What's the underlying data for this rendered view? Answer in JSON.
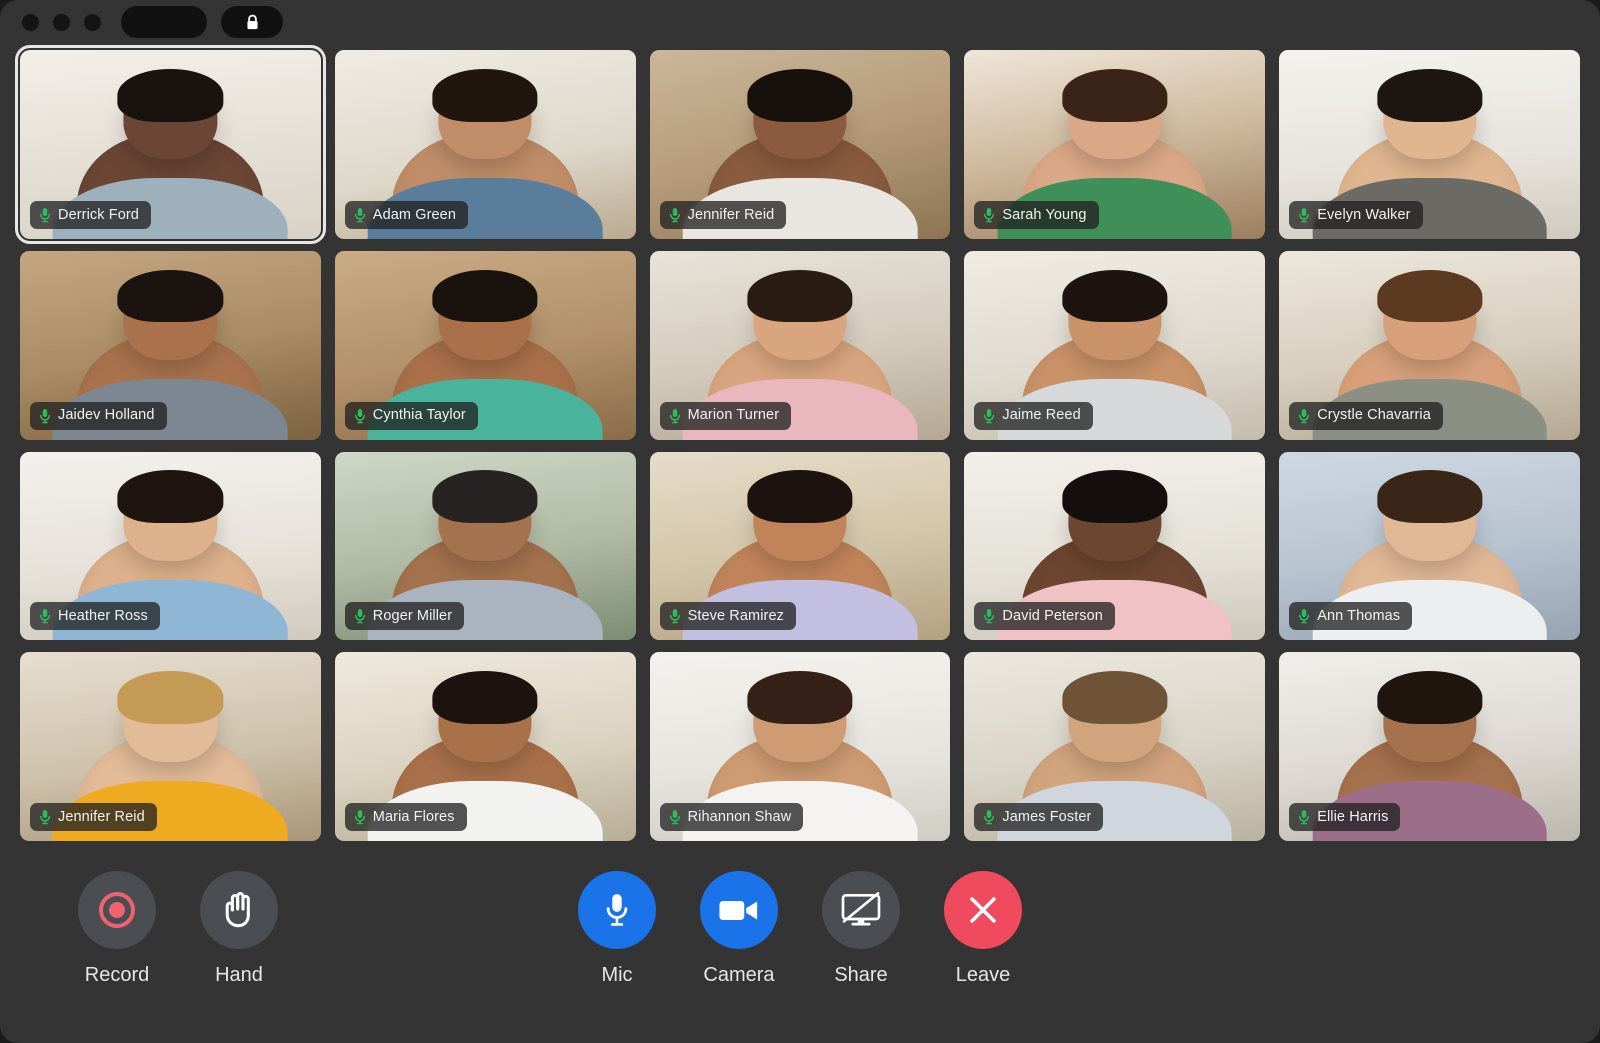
{
  "window": {
    "titlebar": {
      "traffic_lights": [
        "close",
        "minimize",
        "maximize"
      ],
      "pill_wide_label": "",
      "pill_lock_icon": "lock-icon"
    },
    "background_color": "#343434"
  },
  "meeting": {
    "grid": {
      "columns": 5,
      "rows": 4,
      "participant_count": 20
    },
    "active_speaker": "Derrick Ford",
    "participants": [
      {
        "name": "Derrick Ford",
        "mic_icon": "mic-on-icon",
        "mic_status": "on",
        "active": true,
        "skin": "#6b4634",
        "hair": "#191310",
        "shirt": "#9fb0bd",
        "bg": "linear-gradient(175deg,#f2efe9 0%,#e7e2d9 46%,#d8d2c6 100%)"
      },
      {
        "name": "Adam Green",
        "mic_icon": "mic-on-icon",
        "mic_status": "on",
        "active": false,
        "skin": "#c08d68",
        "hair": "#20160f",
        "shirt": "#5b7d9c",
        "bg": "linear-gradient(170deg,#efece4 0%,#ded8ca 58%,#b9a98f 100%)"
      },
      {
        "name": "Jennifer Reid",
        "mic_icon": "mic-on-icon",
        "mic_status": "on",
        "active": false,
        "skin": "#8a5b3e",
        "hair": "#17100c",
        "shirt": "#e9e6e1",
        "bg": "linear-gradient(165deg,#cbb79a 0%,#b59b79 50%,#8d7554 100%)"
      },
      {
        "name": "Sarah Young",
        "mic_icon": "mic-on-icon",
        "mic_status": "on",
        "active": false,
        "skin": "#dba887",
        "hair": "#3a2418",
        "shirt": "#3f8f58",
        "bg": "linear-gradient(170deg,#efe6d8 0%,#cdb79b 52%,#9b7e5e 100%)"
      },
      {
        "name": "Evelyn Walker",
        "mic_icon": "mic-on-icon",
        "mic_status": "on",
        "active": false,
        "skin": "#e0b690",
        "hair": "#1d1512",
        "shirt": "#6c6a64",
        "bg": "linear-gradient(175deg,#f4f2ee 0%,#e6e3dc 60%,#cfcac0 100%)"
      },
      {
        "name": "Jaidev Holland",
        "mic_icon": "mic-on-icon",
        "mic_status": "on",
        "active": false,
        "skin": "#a9724d",
        "hair": "#1b1310",
        "shirt": "#7d8792",
        "bg": "linear-gradient(170deg,#c4a782 0%,#a98b64 52%,#7d6340 100%)"
      },
      {
        "name": "Cynthia Taylor",
        "mic_icon": "mic-on-icon",
        "mic_status": "on",
        "active": false,
        "skin": "#a9704a",
        "hair": "#1a120d",
        "shirt": "#49b39c",
        "bg": "linear-gradient(170deg,#c9ab86 0%,#b1906a 55%,#8a6c49 100%)"
      },
      {
        "name": "Marion Turner",
        "mic_icon": "mic-on-icon",
        "mic_status": "on",
        "active": false,
        "skin": "#d9a57f",
        "hair": "#2b1c13",
        "shirt": "#e9b7bd",
        "bg": "linear-gradient(172deg,#e8e3d9 0%,#d3cabb 55%,#b3a794 100%)"
      },
      {
        "name": "Jaime Reed",
        "mic_icon": "mic-on-icon",
        "mic_status": "on",
        "active": false,
        "skin": "#c99268",
        "hair": "#1d1410",
        "shirt": "#d6d8da",
        "bg": "linear-gradient(172deg,#f0ece4 0%,#dfd9ce 58%,#c4bcac 100%)"
      },
      {
        "name": "Crystle Chavarria",
        "mic_icon": "mic-on-icon",
        "mic_status": "on",
        "active": false,
        "skin": "#d7a07a",
        "hair": "#5c3a22",
        "shirt": "#8b8f84",
        "bg": "linear-gradient(172deg,#ede7dc 0%,#d6cdbd 56%,#b4a892 100%)"
      },
      {
        "name": "Heather Ross",
        "mic_icon": "mic-on-icon",
        "mic_status": "on",
        "active": false,
        "skin": "#dcb18c",
        "hair": "#1e1410",
        "shirt": "#8fb6d4",
        "bg": "linear-gradient(175deg,#f3f1ec 0%,#e6e2da 58%,#d0cabe 100%)"
      },
      {
        "name": "Roger Miller",
        "mic_icon": "mic-on-icon",
        "mic_status": "on",
        "active": false,
        "skin": "#a4724e",
        "hair": "#262322",
        "shirt": "#aab4c0",
        "bg": "linear-gradient(172deg,#cfd6c6 0%,#b0bba4 52%,#7e8c74 100%)"
      },
      {
        "name": "Steve Ramirez",
        "mic_icon": "mic-on-icon",
        "mic_status": "on",
        "active": false,
        "skin": "#c1845a",
        "hair": "#1c130e",
        "shirt": "#c3bfe0",
        "bg": "linear-gradient(172deg,#e6dcc8 0%,#d2c4a8 55%,#b3a181 100%)"
      },
      {
        "name": "David Peterson",
        "mic_icon": "mic-on-icon",
        "mic_status": "on",
        "active": false,
        "skin": "#6d4631",
        "hair": "#140f0c",
        "shirt": "#f0c2c6",
        "bg": "linear-gradient(175deg,#f2f0ea 0%,#e4e1d8 58%,#ccc8bb 100%)"
      },
      {
        "name": "Ann Thomas",
        "mic_icon": "mic-on-icon",
        "mic_status": "on",
        "active": false,
        "skin": "#e1b896",
        "hair": "#3a2519",
        "shirt": "#eceef0",
        "bg": "linear-gradient(172deg,#cfd8e2 0%,#b9c4d1 52%,#97a3b2 100%)"
      },
      {
        "name": "Jennifer Reid",
        "mic_icon": "mic-on-icon",
        "mic_status": "on",
        "active": false,
        "skin": "#e2bb98",
        "hair": "#c49a55",
        "shirt": "#eeab22",
        "bg": "linear-gradient(172deg,#e7ded0 0%,#cfc2ab 55%,#a9967a 100%)"
      },
      {
        "name": "Maria Flores",
        "mic_icon": "mic-on-icon",
        "mic_status": "on",
        "active": false,
        "skin": "#a9714a",
        "hair": "#1c130e",
        "shirt": "#f2f2f0",
        "bg": "linear-gradient(172deg,#efe9dd 0%,#dbd2c0 55%,#b8ae96 100%)"
      },
      {
        "name": "Rihannon Shaw",
        "mic_icon": "mic-on-icon",
        "mic_status": "on",
        "active": false,
        "skin": "#cf9b72",
        "hair": "#352017",
        "shirt": "#f4f3f1",
        "bg": "linear-gradient(175deg,#f3f2ee 0%,#e6e4de 58%,#cfccc3 100%)"
      },
      {
        "name": "James Foster",
        "mic_icon": "mic-on-icon",
        "mic_status": "on",
        "active": false,
        "skin": "#d2a47e",
        "hair": "#6e5336",
        "shirt": "#cfd6dd",
        "bg": "linear-gradient(172deg,#ece8df 0%,#dad4c7 55%,#bab2a0 100%)"
      },
      {
        "name": "Ellie Harris",
        "mic_icon": "mic-on-icon",
        "mic_status": "on",
        "active": false,
        "skin": "#a6714d",
        "hair": "#20150f",
        "shirt": "#9c6e8a",
        "bg": "linear-gradient(172deg,#f1efeb 0%,#ddd9d2 55%,#bdb8ae 100%)"
      }
    ]
  },
  "controls": {
    "left": [
      {
        "label": "Record",
        "icon": "record-icon",
        "style": "gray",
        "state": "off"
      },
      {
        "label": "Hand",
        "icon": "raised-hand-icon",
        "style": "gray",
        "state": "off"
      }
    ],
    "center": [
      {
        "label": "Mic",
        "icon": "microphone-icon",
        "style": "blue",
        "state": "on"
      },
      {
        "label": "Camera",
        "icon": "video-camera-icon",
        "style": "blue",
        "state": "on"
      },
      {
        "label": "Share",
        "icon": "screen-share-off-icon",
        "style": "gray",
        "state": "off"
      },
      {
        "label": "Leave",
        "icon": "close-x-icon",
        "style": "red",
        "state": "action"
      }
    ]
  },
  "colors": {
    "window_bg": "#343434",
    "accent_blue": "#1a73e8",
    "leave_red": "#ef4a5e",
    "mic_green": "#2bbd5e",
    "control_gray": "#4a4d52",
    "active_border": "#e8e6e3"
  }
}
